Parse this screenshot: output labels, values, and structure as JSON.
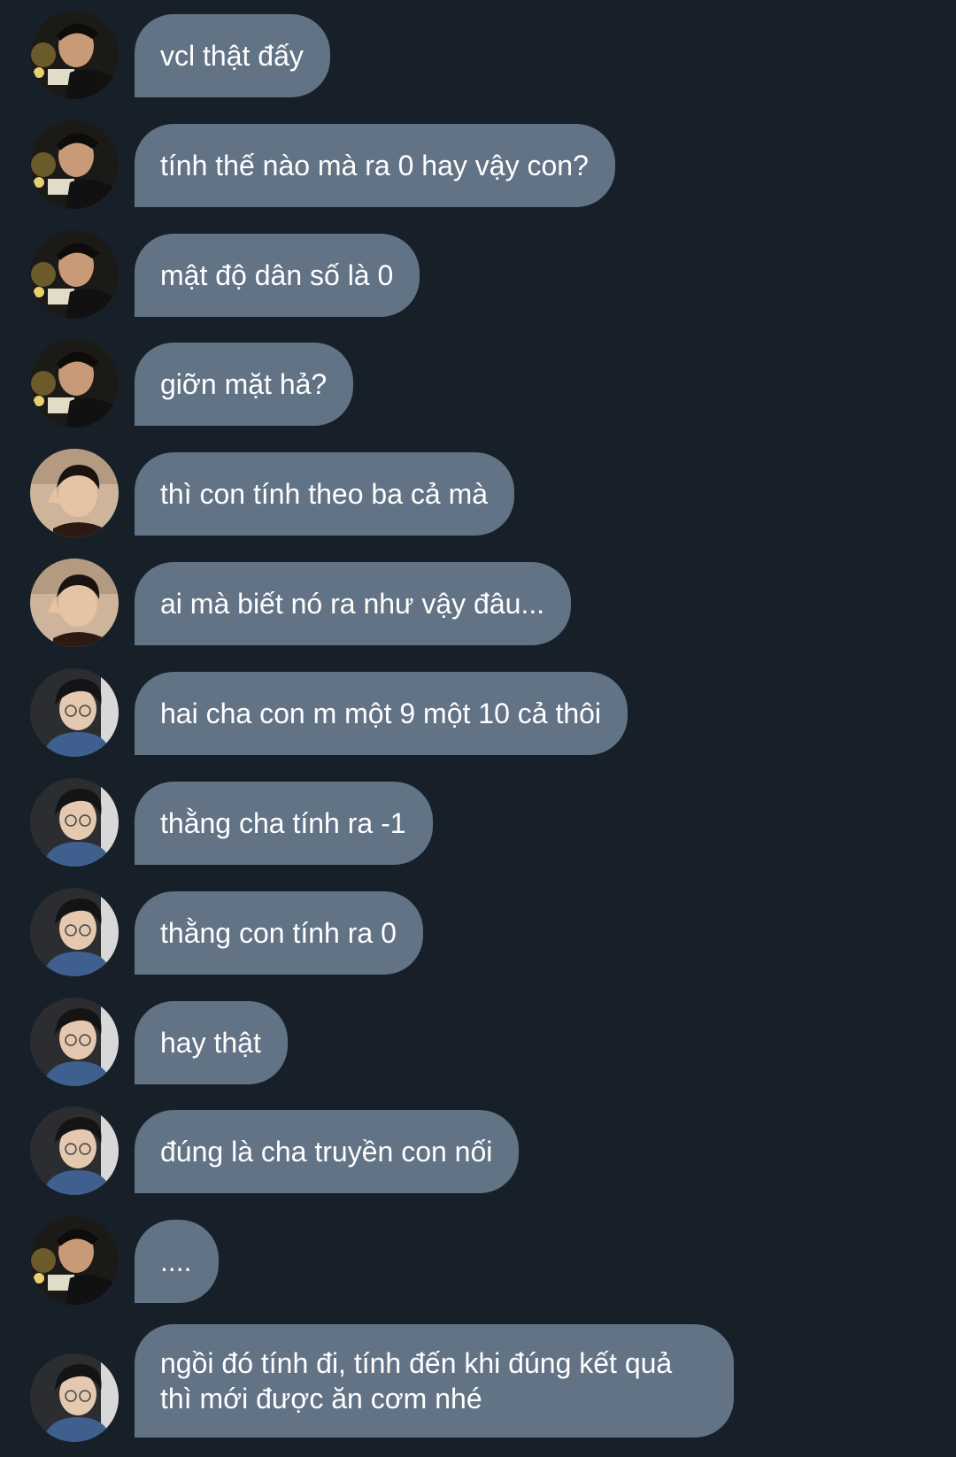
{
  "colors": {
    "background": "#172029",
    "bubble": "#627385",
    "text": "#ffffff"
  },
  "messages": [
    {
      "avatar": "avatar-a",
      "text": "vcl thật đấy"
    },
    {
      "avatar": "avatar-a",
      "text": "tính thế nào mà ra 0 hay vậy con?"
    },
    {
      "avatar": "avatar-a",
      "text": "mật độ dân số là 0"
    },
    {
      "avatar": "avatar-a",
      "text": "giỡn mặt hả?"
    },
    {
      "avatar": "avatar-b",
      "text": "thì con tính theo ba cả mà"
    },
    {
      "avatar": "avatar-b",
      "text": "ai mà biết nó ra như vậy đâu..."
    },
    {
      "avatar": "avatar-c",
      "text": "hai cha con m một 9 một 10 cả thôi"
    },
    {
      "avatar": "avatar-c",
      "text": "thằng cha tính ra -1"
    },
    {
      "avatar": "avatar-c",
      "text": "thằng con tính ra 0"
    },
    {
      "avatar": "avatar-c",
      "text": "hay thật"
    },
    {
      "avatar": "avatar-c",
      "text": "đúng là cha truyền con nối"
    },
    {
      "avatar": "avatar-a",
      "text": "...."
    },
    {
      "avatar": "avatar-c",
      "text": "ngồi đó tính đi, tính đến khi đúng kết quả\nthì mới được ăn cơm nhé"
    }
  ]
}
